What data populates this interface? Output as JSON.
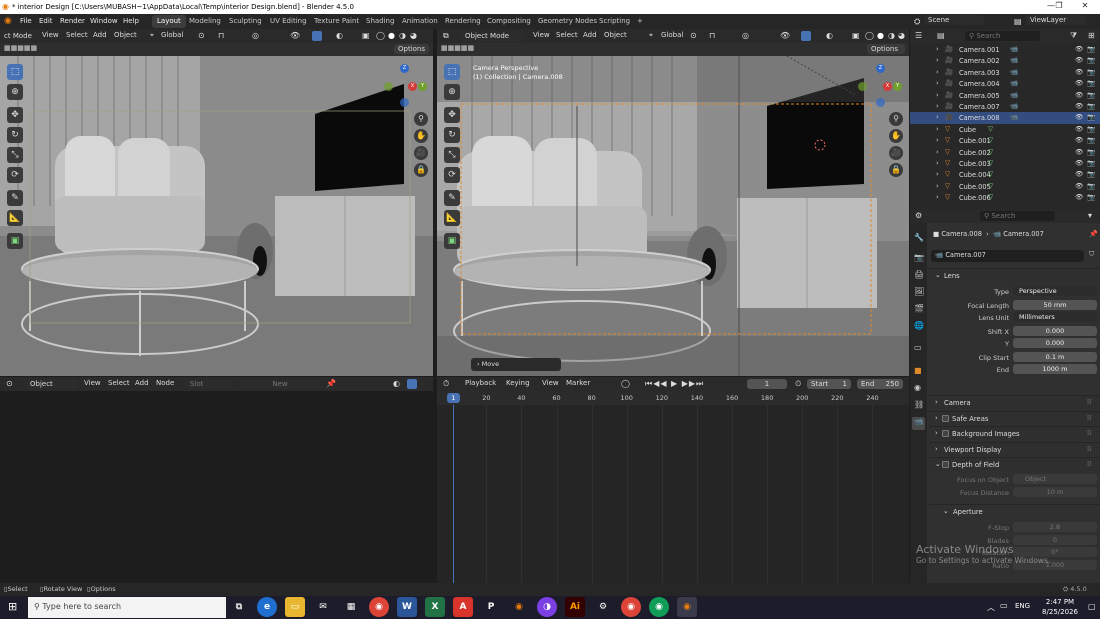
{
  "window": {
    "title": "* interior Design [C:\\Users\\MUBASH~1\\AppData\\Local\\Temp\\interior Design.blend] - Blender 4.5.0"
  },
  "menu": [
    "File",
    "Edit",
    "Render",
    "Window",
    "Help"
  ],
  "workspaces": [
    "Layout",
    "Modeling",
    "Sculpting",
    "UV Editing",
    "Texture Paint",
    "Shading",
    "Animation",
    "Rendering",
    "Compositing",
    "Geometry Nodes",
    "Scripting",
    "+"
  ],
  "topright": {
    "scene": "Scene",
    "viewlayer": "ViewLayer"
  },
  "vp_left": {
    "mode": "ct Mode",
    "view": "View",
    "select": "Select",
    "add": "Add",
    "object": "Object",
    "orientation": "Global",
    "options": "Options"
  },
  "vp_right": {
    "mode": "Object Mode",
    "view": "View",
    "select": "Select",
    "add": "Add",
    "object": "Object",
    "orientation": "Global",
    "options": "Options",
    "overlay_title": "Camera Perspective",
    "overlay_sub": "(1) Collection | Camera.008",
    "last_op": "Move"
  },
  "outliner": {
    "search_placeholder": "Search",
    "rows": [
      "Camera.001",
      "Camera.002",
      "Camera.003",
      "Camera.004",
      "Camera.005",
      "Camera.007",
      "Camera.008",
      "Cube",
      "Cube.001",
      "Cube.002",
      "Cube.003",
      "Cube.004",
      "Cube.005",
      "Cube.006"
    ],
    "selected": "Camera.008"
  },
  "properties": {
    "search_placeholder": "Search",
    "breadcrumb": [
      "Camera.008",
      "Camera.007"
    ],
    "datablock": "Camera.007",
    "lens_title": "Lens",
    "fields": [
      {
        "label": "Type",
        "value": "Perspective",
        "kind": "dd"
      },
      {
        "label": "Focal Length",
        "value": "50 mm",
        "kind": "num"
      },
      {
        "label": "Lens Unit",
        "value": "Millimeters",
        "kind": "dd"
      },
      {
        "label": "Shift X",
        "value": "0.000",
        "kind": "num"
      },
      {
        "label": "Y",
        "value": "0.000",
        "kind": "num"
      },
      {
        "label": "Clip Start",
        "value": "0.1 m",
        "kind": "num"
      },
      {
        "label": "End",
        "value": "1000 m",
        "kind": "num"
      }
    ],
    "sections": [
      "Camera",
      "Safe Areas",
      "Background Images",
      "Viewport Display",
      "Depth of Field"
    ],
    "dof": [
      {
        "label": "Focus on Object",
        "value": "Object"
      },
      {
        "label": "Focus Distance",
        "value": "10 m"
      }
    ],
    "aperture_title": "Aperture",
    "aperture": [
      {
        "label": "F-Stop",
        "value": "2.8"
      },
      {
        "label": "Blades",
        "value": "0"
      },
      {
        "label": "Rotation",
        "value": "0°"
      },
      {
        "label": "Ratio",
        "value": "1.000"
      }
    ]
  },
  "nodeeditor": {
    "type": "Object",
    "view": "View",
    "select": "Select",
    "add": "Add",
    "node": "Node",
    "slot": "Slot",
    "new": "New"
  },
  "timeline": {
    "playback": "Playback",
    "keying": "Keying",
    "view": "View",
    "marker": "Marker",
    "current_frame": "1",
    "start_label": "Start",
    "start": "1",
    "end_label": "End",
    "end": "250",
    "ticks": [
      "20",
      "40",
      "60",
      "80",
      "100",
      "120",
      "140",
      "160",
      "180",
      "200",
      "220",
      "240"
    ],
    "playhead": "1"
  },
  "statusbar": {
    "select": "Select",
    "rotate": "Rotate View",
    "options": "Options",
    "version": "4.5.0"
  },
  "watermark": {
    "title": "Activate Windows",
    "sub": "Go to Settings to activate Windows."
  },
  "taskbar": {
    "search_placeholder": "Type here to search",
    "time": "2:47 PM",
    "date": "8/25/2026",
    "lang": "ENG"
  },
  "colors": {
    "accent": "#4772b3",
    "selection": "#e08a2c",
    "header": "#2a2a2a",
    "panel": "#303030"
  }
}
